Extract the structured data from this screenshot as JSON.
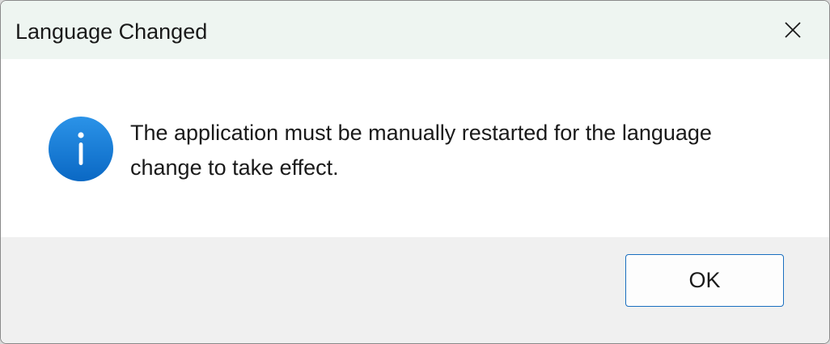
{
  "dialog": {
    "title": "Language Changed",
    "message": "The application must be manually restarted for the language change to take effect.",
    "icon": "info-icon",
    "ok_label": "OK",
    "close_icon": "close-icon"
  },
  "colors": {
    "titlebar_bg": "#eef5f1",
    "footer_bg": "#f0f0f0",
    "icon_blue": "#0f7ad8",
    "button_border": "#1a6fc0"
  }
}
